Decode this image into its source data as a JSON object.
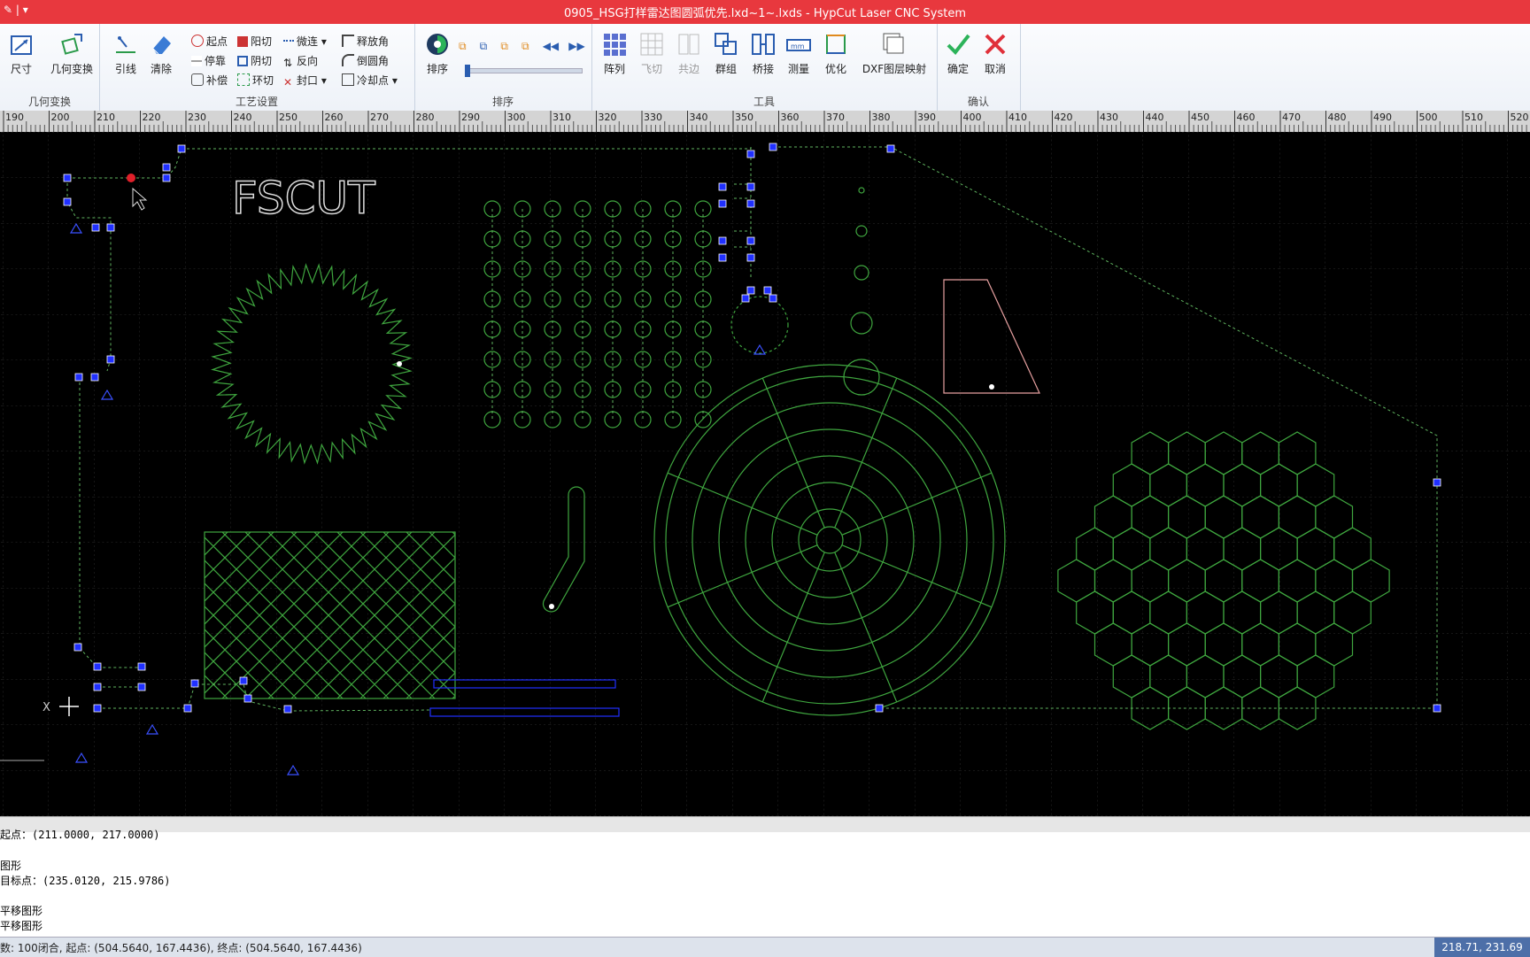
{
  "window": {
    "title": "0905_HSG打样雷达图圆弧优先.lxd~1~.lxds - HypCut Laser CNC System",
    "quick_access": "✎ | ▾"
  },
  "ribbon": {
    "groups": {
      "geo": "几何变换",
      "process": "工艺设置",
      "sort": "排序",
      "tools": "工具",
      "confirm": "确认"
    },
    "size": "尺寸",
    "geo_transform": "几何变换",
    "lead": "引线",
    "clear": "清除",
    "start": "起点",
    "stop": "停靠",
    "compensate": "补偿",
    "outer_cut": "阳切",
    "inner_cut": "阴切",
    "ring_cut": "环切",
    "micro_joint": "微连",
    "reverse": "反向",
    "seal": "封口",
    "release_angle": "释放角",
    "round_corner": "倒圆角",
    "cooling_point": "冷却点",
    "sort": "排序",
    "array": "阵列",
    "fly_cut": "飞切",
    "common_edge": "共边",
    "group": "群组",
    "bridge": "桥接",
    "measure": "测量",
    "optimize": "优化",
    "dxf_map": "DXF图层映射",
    "ok": "确定",
    "cancel": "取消"
  },
  "ruler": {
    "labels": [
      "190",
      "200",
      "210",
      "220",
      "230",
      "240",
      "250",
      "260",
      "270",
      "280",
      "290",
      "300",
      "310",
      "320",
      "330",
      "340",
      "350",
      "360",
      "370",
      "380",
      "390",
      "400",
      "410",
      "420",
      "430",
      "440",
      "450",
      "460",
      "470",
      "480",
      "490",
      "500",
      "510",
      "520"
    ]
  },
  "canvas": {
    "text": "FSCUT",
    "axis_label": "X"
  },
  "console": {
    "lines": [
      "起点：(211.0000, 217.0000)",
      "图形",
      "目标点：(235.0120, 215.9786)",
      "",
      "平移图形",
      "平移图形"
    ]
  },
  "status": {
    "left": "数: 100闭合, 起点: (504.5640, 167.4436), 终点: (504.5640, 167.4436)",
    "coords": "218.71, 231.69"
  },
  "colors": {
    "title_bar": "#e8383e",
    "part_green": "#3fa63f",
    "select_blue": "#2030ff"
  }
}
